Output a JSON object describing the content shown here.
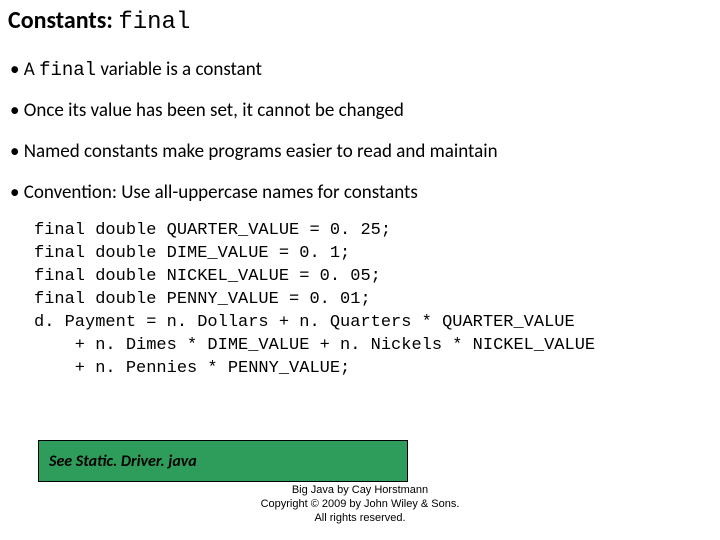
{
  "title_prefix": "Constants: ",
  "title_keyword": "final",
  "bullets": {
    "b1_pre": "• A ",
    "b1_kw": "final",
    "b1_post": " variable is a constant",
    "b2": "• Once its value has been set, it cannot be changed",
    "b3": "• Named constants make programs easier to read and maintain",
    "b4": "• Convention: Use all-uppercase names for constants"
  },
  "code": "final double QUARTER_VALUE = 0. 25;\nfinal double DIME_VALUE = 0. 1;\nfinal double NICKEL_VALUE = 0. 05;\nfinal double PENNY_VALUE = 0. 01;\nd. Payment = n. Dollars + n. Quarters * QUARTER_VALUE\n    + n. Dimes * DIME_VALUE + n. Nickels * NICKEL_VALUE\n    + n. Pennies * PENNY_VALUE;",
  "reference": "See Static. Driver. java",
  "footer_line1": "Big Java by Cay Horstmann",
  "footer_line2": "Copyright © 2009 by John Wiley & Sons.",
  "footer_line3": "All rights reserved."
}
